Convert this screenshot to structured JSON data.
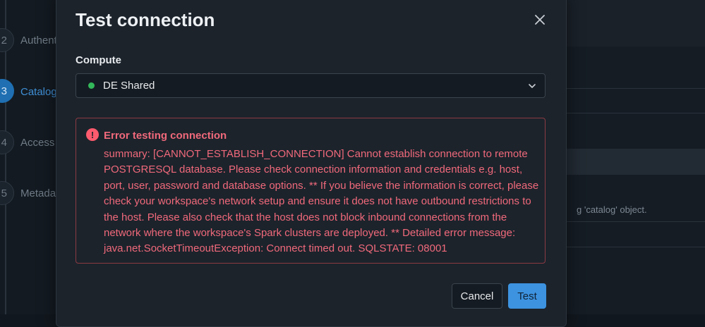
{
  "background": {
    "steps": [
      {
        "number": "2",
        "label": "Authent",
        "active": false
      },
      {
        "number": "3",
        "label": "Catalog",
        "active": true
      },
      {
        "number": "4",
        "label": "Access",
        "active": false
      },
      {
        "number": "5",
        "label": "Metada",
        "active": false
      }
    ],
    "right_text": "g 'catalog' object."
  },
  "modal": {
    "title": "Test connection",
    "close_icon": "close-icon",
    "compute": {
      "label": "Compute",
      "selected": "DE Shared",
      "status_color": "#33b85a"
    },
    "error": {
      "icon": "error-icon",
      "icon_glyph": "!",
      "title": "Error testing connection",
      "message": "summary: [CANNOT_ESTABLISH_CONNECTION] Cannot establish connection to remote POSTGRESQL database. Please check connection information and credentials e.g. host, port, user, password and database options. ** If you believe the information is correct, please check your workspace's network setup and ensure it does not have outbound restrictions to the host. Please also check that the host does not block inbound connections from the network where the workspace's Spark clusters are deployed. ** Detailed error message: java.net.SocketTimeoutException: Connect timed out. SQLSTATE: 08001"
    },
    "buttons": {
      "cancel": "Cancel",
      "test": "Test"
    }
  },
  "colors": {
    "accent": "#3d93e0",
    "error": "#f0697b",
    "modal_bg": "#1c232b"
  }
}
